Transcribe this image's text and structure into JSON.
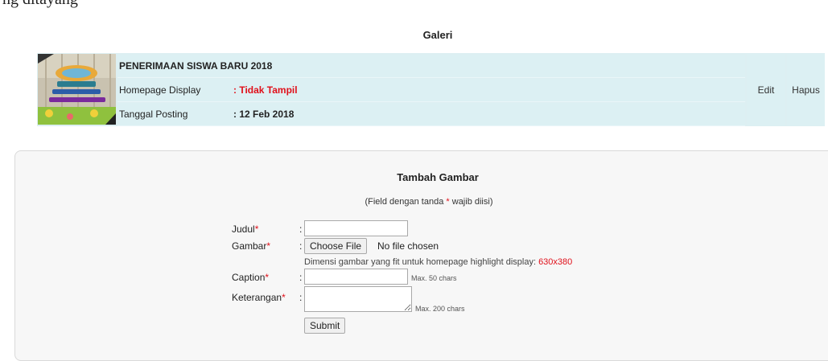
{
  "top_text": "ng ditayang",
  "gallery": {
    "title": "Galeri",
    "item": {
      "title": "PENERIMAAN SISWA BARU 2018",
      "display_label": "Homepage Display",
      "display_value": ": Tidak Tampil",
      "date_label": "Tanggal Posting",
      "date_value": ": 12 Feb 2018",
      "edit_label": "Edit",
      "delete_label": "Hapus"
    }
  },
  "form": {
    "title": "Tambah Gambar",
    "note_prefix": "(Field dengan tanda",
    "note_star": "*",
    "note_suffix": "wajib diisi)",
    "judul_label": "Judul",
    "gambar_label": "Gambar",
    "caption_label": "Caption",
    "keterangan_label": "Keterangan",
    "required_mark": "*",
    "colon": ":",
    "file_button": "Choose File",
    "file_status": "No file chosen",
    "hint_text": "Dimensi gambar yang fit untuk homepage highlight display:",
    "hint_dimension": "630x380",
    "caption_max": "Max. 50 chars",
    "keterangan_max": "Max. 200 chars",
    "submit_label": "Submit"
  },
  "colors": {
    "row_bg": "#dcf0f3",
    "required": "#e0101a",
    "panel_bg": "#f7f7f7"
  }
}
